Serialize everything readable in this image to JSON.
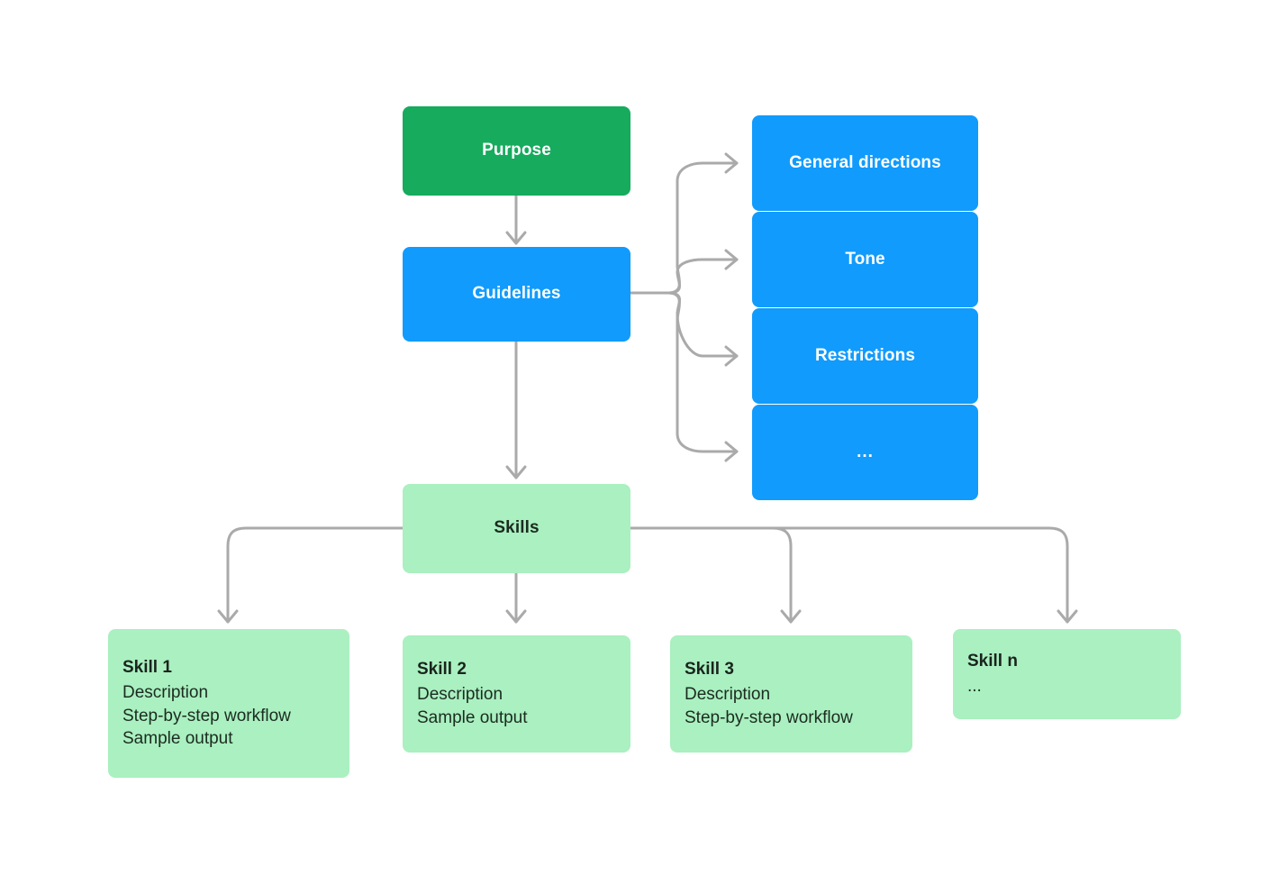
{
  "diagram": {
    "root": {
      "label": "Purpose",
      "color": "#16ab5d"
    },
    "guidelines": {
      "label": "Guidelines",
      "color": "#119bfc"
    },
    "guideline_items": [
      {
        "label": "General directions"
      },
      {
        "label": "Tone"
      },
      {
        "label": "Restrictions"
      },
      {
        "label": "..."
      }
    ],
    "skills": {
      "label": "Skills",
      "color": "#aaf0c0"
    },
    "skill_cards": [
      {
        "title": "Skill 1",
        "lines": [
          "Description",
          "Step-by-step workflow",
          "Sample output"
        ]
      },
      {
        "title": "Skill 2",
        "lines": [
          "Description",
          "Sample output"
        ]
      },
      {
        "title": "Skill 3",
        "lines": [
          "Description",
          "Step-by-step workflow"
        ]
      },
      {
        "title": "Skill n",
        "lines": [
          "..."
        ]
      }
    ],
    "colors": {
      "green": "#16ab5d",
      "blue": "#119bfc",
      "light_green": "#aaf0c0",
      "connector_gray": "#aaaaaa",
      "background": "#ffffff",
      "dark_text": "#1b2b20",
      "white_text": "#ffffff"
    }
  }
}
